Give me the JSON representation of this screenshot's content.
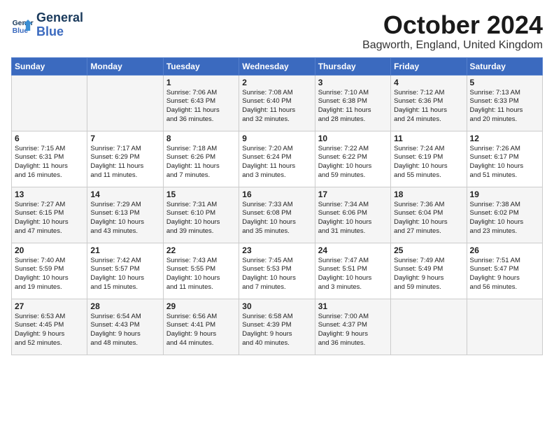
{
  "header": {
    "logo_line1": "General",
    "logo_line2": "Blue",
    "month_title": "October 2024",
    "location": "Bagworth, England, United Kingdom"
  },
  "weekdays": [
    "Sunday",
    "Monday",
    "Tuesday",
    "Wednesday",
    "Thursday",
    "Friday",
    "Saturday"
  ],
  "weeks": [
    [
      {
        "day": "",
        "content": ""
      },
      {
        "day": "",
        "content": ""
      },
      {
        "day": "1",
        "content": "Sunrise: 7:06 AM\nSunset: 6:43 PM\nDaylight: 11 hours\nand 36 minutes."
      },
      {
        "day": "2",
        "content": "Sunrise: 7:08 AM\nSunset: 6:40 PM\nDaylight: 11 hours\nand 32 minutes."
      },
      {
        "day": "3",
        "content": "Sunrise: 7:10 AM\nSunset: 6:38 PM\nDaylight: 11 hours\nand 28 minutes."
      },
      {
        "day": "4",
        "content": "Sunrise: 7:12 AM\nSunset: 6:36 PM\nDaylight: 11 hours\nand 24 minutes."
      },
      {
        "day": "5",
        "content": "Sunrise: 7:13 AM\nSunset: 6:33 PM\nDaylight: 11 hours\nand 20 minutes."
      }
    ],
    [
      {
        "day": "6",
        "content": "Sunrise: 7:15 AM\nSunset: 6:31 PM\nDaylight: 11 hours\nand 16 minutes."
      },
      {
        "day": "7",
        "content": "Sunrise: 7:17 AM\nSunset: 6:29 PM\nDaylight: 11 hours\nand 11 minutes."
      },
      {
        "day": "8",
        "content": "Sunrise: 7:18 AM\nSunset: 6:26 PM\nDaylight: 11 hours\nand 7 minutes."
      },
      {
        "day": "9",
        "content": "Sunrise: 7:20 AM\nSunset: 6:24 PM\nDaylight: 11 hours\nand 3 minutes."
      },
      {
        "day": "10",
        "content": "Sunrise: 7:22 AM\nSunset: 6:22 PM\nDaylight: 10 hours\nand 59 minutes."
      },
      {
        "day": "11",
        "content": "Sunrise: 7:24 AM\nSunset: 6:19 PM\nDaylight: 10 hours\nand 55 minutes."
      },
      {
        "day": "12",
        "content": "Sunrise: 7:26 AM\nSunset: 6:17 PM\nDaylight: 10 hours\nand 51 minutes."
      }
    ],
    [
      {
        "day": "13",
        "content": "Sunrise: 7:27 AM\nSunset: 6:15 PM\nDaylight: 10 hours\nand 47 minutes."
      },
      {
        "day": "14",
        "content": "Sunrise: 7:29 AM\nSunset: 6:13 PM\nDaylight: 10 hours\nand 43 minutes."
      },
      {
        "day": "15",
        "content": "Sunrise: 7:31 AM\nSunset: 6:10 PM\nDaylight: 10 hours\nand 39 minutes."
      },
      {
        "day": "16",
        "content": "Sunrise: 7:33 AM\nSunset: 6:08 PM\nDaylight: 10 hours\nand 35 minutes."
      },
      {
        "day": "17",
        "content": "Sunrise: 7:34 AM\nSunset: 6:06 PM\nDaylight: 10 hours\nand 31 minutes."
      },
      {
        "day": "18",
        "content": "Sunrise: 7:36 AM\nSunset: 6:04 PM\nDaylight: 10 hours\nand 27 minutes."
      },
      {
        "day": "19",
        "content": "Sunrise: 7:38 AM\nSunset: 6:02 PM\nDaylight: 10 hours\nand 23 minutes."
      }
    ],
    [
      {
        "day": "20",
        "content": "Sunrise: 7:40 AM\nSunset: 5:59 PM\nDaylight: 10 hours\nand 19 minutes."
      },
      {
        "day": "21",
        "content": "Sunrise: 7:42 AM\nSunset: 5:57 PM\nDaylight: 10 hours\nand 15 minutes."
      },
      {
        "day": "22",
        "content": "Sunrise: 7:43 AM\nSunset: 5:55 PM\nDaylight: 10 hours\nand 11 minutes."
      },
      {
        "day": "23",
        "content": "Sunrise: 7:45 AM\nSunset: 5:53 PM\nDaylight: 10 hours\nand 7 minutes."
      },
      {
        "day": "24",
        "content": "Sunrise: 7:47 AM\nSunset: 5:51 PM\nDaylight: 10 hours\nand 3 minutes."
      },
      {
        "day": "25",
        "content": "Sunrise: 7:49 AM\nSunset: 5:49 PM\nDaylight: 9 hours\nand 59 minutes."
      },
      {
        "day": "26",
        "content": "Sunrise: 7:51 AM\nSunset: 5:47 PM\nDaylight: 9 hours\nand 56 minutes."
      }
    ],
    [
      {
        "day": "27",
        "content": "Sunrise: 6:53 AM\nSunset: 4:45 PM\nDaylight: 9 hours\nand 52 minutes."
      },
      {
        "day": "28",
        "content": "Sunrise: 6:54 AM\nSunset: 4:43 PM\nDaylight: 9 hours\nand 48 minutes."
      },
      {
        "day": "29",
        "content": "Sunrise: 6:56 AM\nSunset: 4:41 PM\nDaylight: 9 hours\nand 44 minutes."
      },
      {
        "day": "30",
        "content": "Sunrise: 6:58 AM\nSunset: 4:39 PM\nDaylight: 9 hours\nand 40 minutes."
      },
      {
        "day": "31",
        "content": "Sunrise: 7:00 AM\nSunset: 4:37 PM\nDaylight: 9 hours\nand 36 minutes."
      },
      {
        "day": "",
        "content": ""
      },
      {
        "day": "",
        "content": ""
      }
    ]
  ]
}
